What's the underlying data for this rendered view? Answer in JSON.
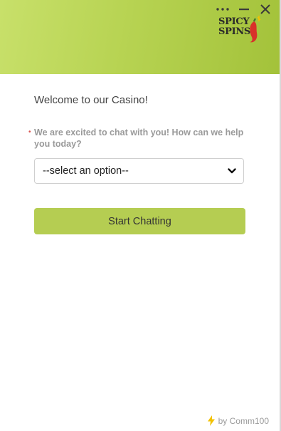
{
  "header": {
    "brand_line1": "SPICY",
    "brand_line2": "SPINS",
    "colors": {
      "header_start": "#c8e06a",
      "header_end": "#a3c23a",
      "chili": "#d8322a"
    }
  },
  "window_controls": [
    "more-options-icon",
    "minimize-icon",
    "close-icon"
  ],
  "form": {
    "welcome": "Welcome to our Casino!",
    "required_mark": "•",
    "question": "We are excited to chat with you! How can we help you today?",
    "select_value": "--select an option--",
    "submit_label": "Start Chatting",
    "button_color": "#b5cd52"
  },
  "footer": {
    "text": "by Comm100",
    "icon": "lightning-bolt-icon"
  }
}
